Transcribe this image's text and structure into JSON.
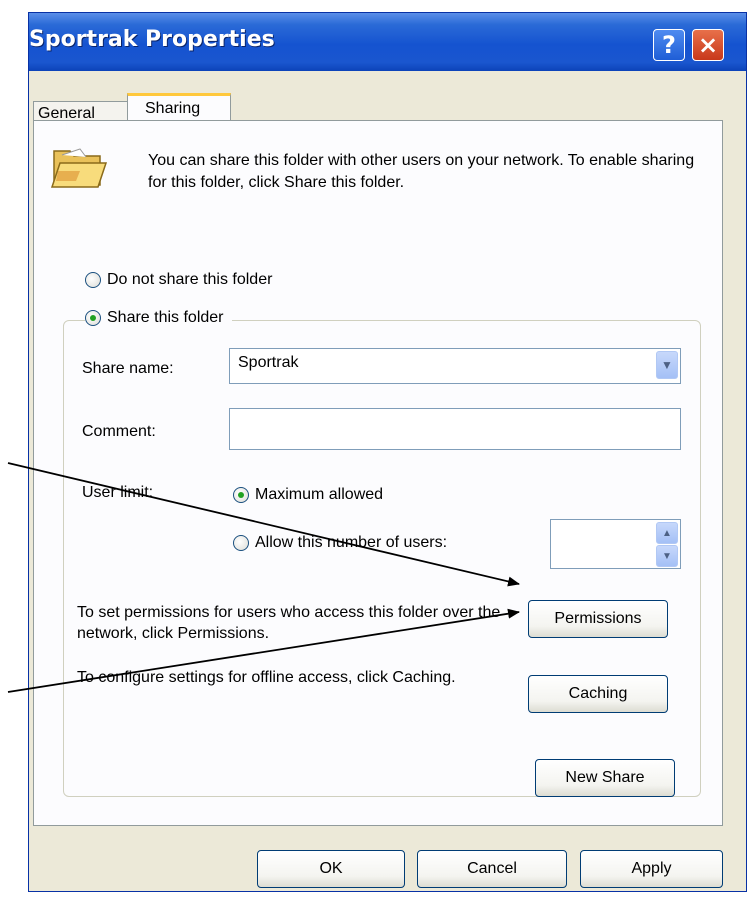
{
  "window": {
    "title": "Sportrak Properties",
    "help_label": "?",
    "close_label": "×"
  },
  "tabs": [
    {
      "label": "General"
    },
    {
      "label": "Sharing"
    }
  ],
  "intro_text": "You can share this folder with other users on your network.  To enable sharing for this folder, click Share this folder.",
  "sharing": {
    "do_not_share_label": "Do not share this folder",
    "share_label": "Share this folder",
    "selected": "share",
    "share_name_label": "Share name:",
    "share_name_value": "Sportrak",
    "comment_label": "Comment:",
    "comment_value": "",
    "user_limit_label": "User limit:",
    "max_allowed_label": "Maximum allowed",
    "allow_number_label": "Allow this number of users:",
    "user_count_value": "",
    "user_limit_selected": "maximum"
  },
  "permissions": {
    "text": "To set permissions for users who access this folder over the network, click Permissions.",
    "button_label": "Permissions"
  },
  "caching": {
    "text": "To configure settings for offline access, click Caching.",
    "button_label": "Caching"
  },
  "new_share_label": "New Share",
  "footer": {
    "ok_label": "OK",
    "cancel_label": "Cancel",
    "apply_label": "Apply"
  },
  "icons": {
    "folder": "open-folder-icon",
    "combo": "chevron-down-icon",
    "spin_up": "up-arrow-icon",
    "spin_down": "down-arrow-icon"
  },
  "colors": {
    "titlebar": "#1553d0",
    "dialog_bg": "#ece9d8",
    "radio_dot": "#21a121",
    "tab_highlight": "#ffc83c"
  }
}
